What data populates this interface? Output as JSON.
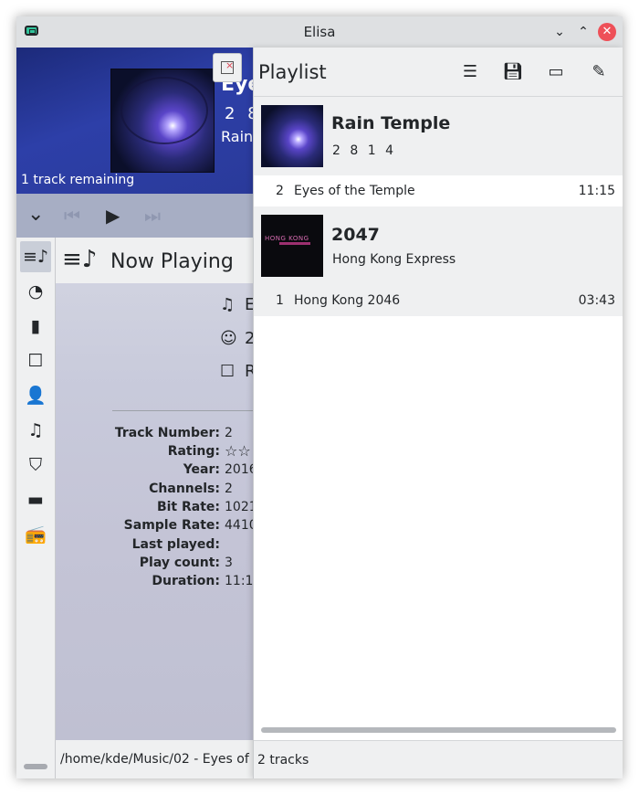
{
  "window": {
    "title": "Elisa"
  },
  "titlebar": {
    "minimize_glyph": "⌄",
    "maximize_glyph": "⌃",
    "close_glyph": "✕"
  },
  "header": {
    "title": "Eye",
    "album": "2 8",
    "artist": "Rain",
    "remaining": "1 track remaining"
  },
  "controls": {
    "collapse_glyph": "⌄",
    "prev_glyph": "⏮",
    "play_glyph": "▶",
    "next_glyph": "⏭"
  },
  "sidebar": {
    "items": [
      {
        "name": "now-playing",
        "glyph": "≡♪"
      },
      {
        "name": "recently-played",
        "glyph": "◔"
      },
      {
        "name": "frequently-played",
        "glyph": "▮"
      },
      {
        "name": "albums",
        "glyph": "☐"
      },
      {
        "name": "artists",
        "glyph": "👤"
      },
      {
        "name": "tracks",
        "glyph": "♫"
      },
      {
        "name": "genres",
        "glyph": "⛉"
      },
      {
        "name": "files",
        "glyph": "▬"
      },
      {
        "name": "radios",
        "glyph": "📻"
      }
    ]
  },
  "now_playing": {
    "heading": "Now Playing",
    "meta_title": "E",
    "meta_artist": "2",
    "meta_album": "R",
    "details": [
      {
        "label": "Track Number:",
        "value": "2"
      },
      {
        "label": "Rating:",
        "value": "☆☆"
      },
      {
        "label": "Year:",
        "value": "2016"
      },
      {
        "label": "Channels:",
        "value": "2"
      },
      {
        "label": "Bit Rate:",
        "value": "1021"
      },
      {
        "label": "Sample Rate:",
        "value": "4410"
      },
      {
        "label": "Last played:",
        "value": ""
      },
      {
        "label": "Play count:",
        "value": "3"
      },
      {
        "label": "Duration:",
        "value": "11:1"
      }
    ],
    "path": "/home/kde/Music/02 - Eyes of t"
  },
  "playlist": {
    "title": "Playlist",
    "groups": [
      {
        "album": "Rain Temple",
        "artist": "2 8 1 4",
        "tracks": [
          {
            "number": "2",
            "title": "Eyes of the Temple",
            "duration": "11:15"
          }
        ]
      },
      {
        "album": "2047",
        "artist": "Hong Kong Express",
        "cover_text": "HONG KONG",
        "tracks": [
          {
            "number": "1",
            "title": "Hong Kong 2046",
            "duration": "03:43"
          }
        ]
      }
    ],
    "count": "2 tracks"
  },
  "colors": {
    "accent": "#3daee9",
    "close": "#ee5058",
    "header_bg": "#2d3fa8",
    "control_bar": "#a7aec4"
  }
}
